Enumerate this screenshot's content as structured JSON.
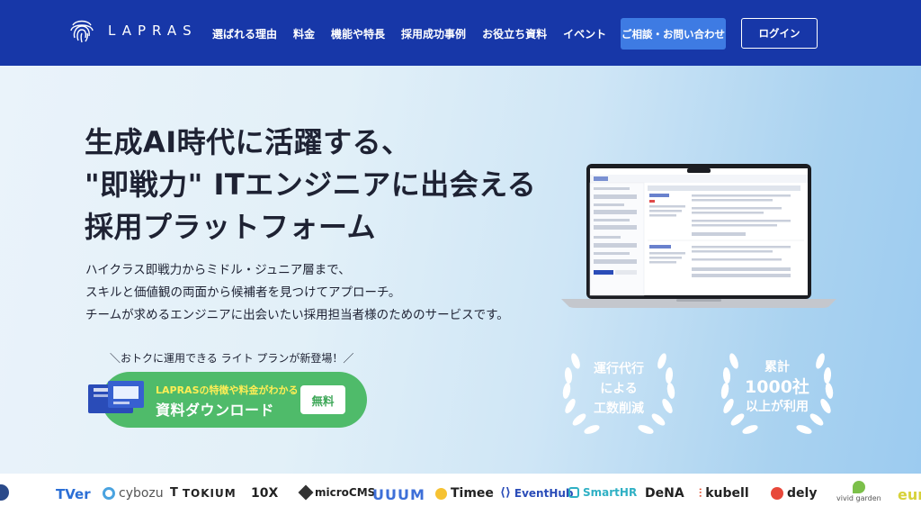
{
  "header": {
    "brand": "LAPRAS",
    "nav": [
      {
        "label": "選ばれる理由"
      },
      {
        "label": "料金"
      },
      {
        "label": "機能や特長"
      },
      {
        "label": "採用成功事例"
      },
      {
        "label": "お役立ち資料"
      },
      {
        "label": "イベント"
      }
    ],
    "contact_label": "ご相談・お問い合わせ",
    "login_label": "ログイン"
  },
  "hero": {
    "headline": [
      "生成AI時代に活躍する、",
      "\"即戦力\" ITエンジニアに出会える",
      "採用プラットフォーム"
    ],
    "lead": [
      "ハイクラス即戦力からミドル・ジュニア層まで、",
      "スキルと価値観の両面から候補者を見つけてアプローチ。",
      "チームが求めるエンジニアに出会いたい採用担当者様のためのサービスです。"
    ],
    "promo_caption": "＼おトクに運用できる ライト プランが新登場！／",
    "cta": {
      "sub": "LAPRASの特徴や料金がわかる",
      "main": "資料ダウンロード",
      "badge": "無料"
    },
    "badges": [
      {
        "lines": [
          "運行代行",
          "による",
          "工数削減"
        ]
      },
      {
        "lines": [
          "累計",
          "1000社",
          "以上が利用"
        ]
      }
    ]
  },
  "logos": [
    {
      "name": "TVer"
    },
    {
      "name": "cybozu"
    },
    {
      "name": "TOKIUM"
    },
    {
      "name": "10X"
    },
    {
      "name": "microCMS"
    },
    {
      "name": "UUUM"
    },
    {
      "name": "Timee"
    },
    {
      "name": "EventHub"
    },
    {
      "name": "SmartHR"
    },
    {
      "name": "DeNA"
    },
    {
      "name": "kubell"
    },
    {
      "name": "dely"
    },
    {
      "name": "vivid garden"
    },
    {
      "name": "eur"
    }
  ],
  "colors": {
    "header_bg": "#1737a8",
    "contact_bg": "#3e7be3",
    "cta_green": "#4fbb6a",
    "cta_sub_yellow": "#ffee55"
  }
}
